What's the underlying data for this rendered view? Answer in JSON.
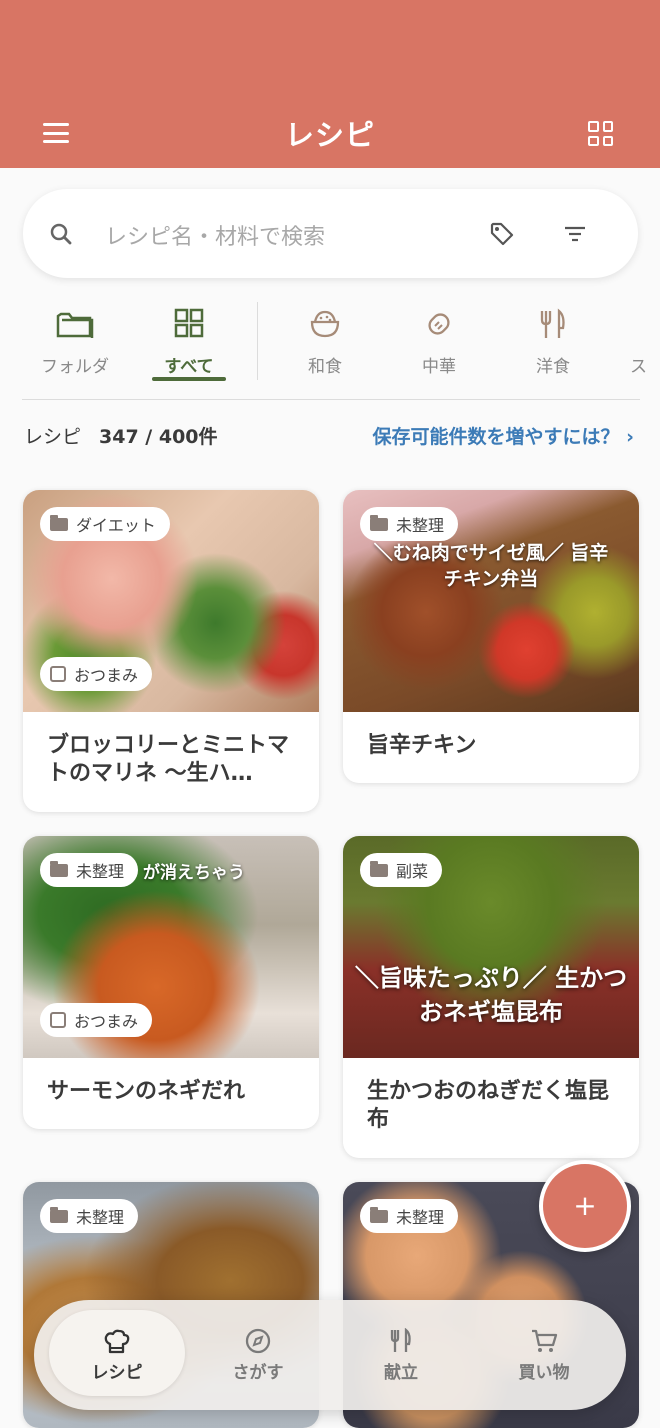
{
  "header": {
    "title": "レシピ"
  },
  "search": {
    "placeholder": "レシピ名・材料で検索"
  },
  "categories": [
    {
      "label": "フォルダ"
    },
    {
      "label": "すべて"
    },
    {
      "label": "和食"
    },
    {
      "label": "中華"
    },
    {
      "label": "洋食"
    }
  ],
  "summary": {
    "label": "レシピ",
    "count": "347 / 400件",
    "upgrade_link": "保存可能件数を増やすには？ ›"
  },
  "recipes": [
    {
      "name": "ブロッコリーとミニトマトのマリネ ～生ハ…",
      "folder": "ダイエット",
      "tag": "おつまみ"
    },
    {
      "name": "旨辛チキン",
      "folder": "未整理",
      "tag": "",
      "overlay_text": "＼むね肉でサイゼ風／ 旨辛チキン弁当"
    },
    {
      "name": "サーモンのネギだれ",
      "folder": "未整理",
      "tag": "おつまみ",
      "overlay_text": "が消えちゃう"
    },
    {
      "name": "生かつおのねぎだく塩昆布",
      "folder": "副菜",
      "tag": "",
      "overlay_text": "＼旨味たっぷり／ 生かつおネギ塩昆布"
    },
    {
      "name": "",
      "folder": "未整理",
      "tag": ""
    },
    {
      "name": "",
      "folder": "未整理",
      "tag": ""
    }
  ],
  "fab": {
    "label": "+"
  },
  "bottom_nav": [
    {
      "label": "レシピ"
    },
    {
      "label": "さがす"
    },
    {
      "label": "献立"
    },
    {
      "label": "買い物"
    }
  ],
  "colors": {
    "header": "#d87564",
    "accent_green": "#4e6b3a",
    "link_blue": "#3c7bb7"
  }
}
